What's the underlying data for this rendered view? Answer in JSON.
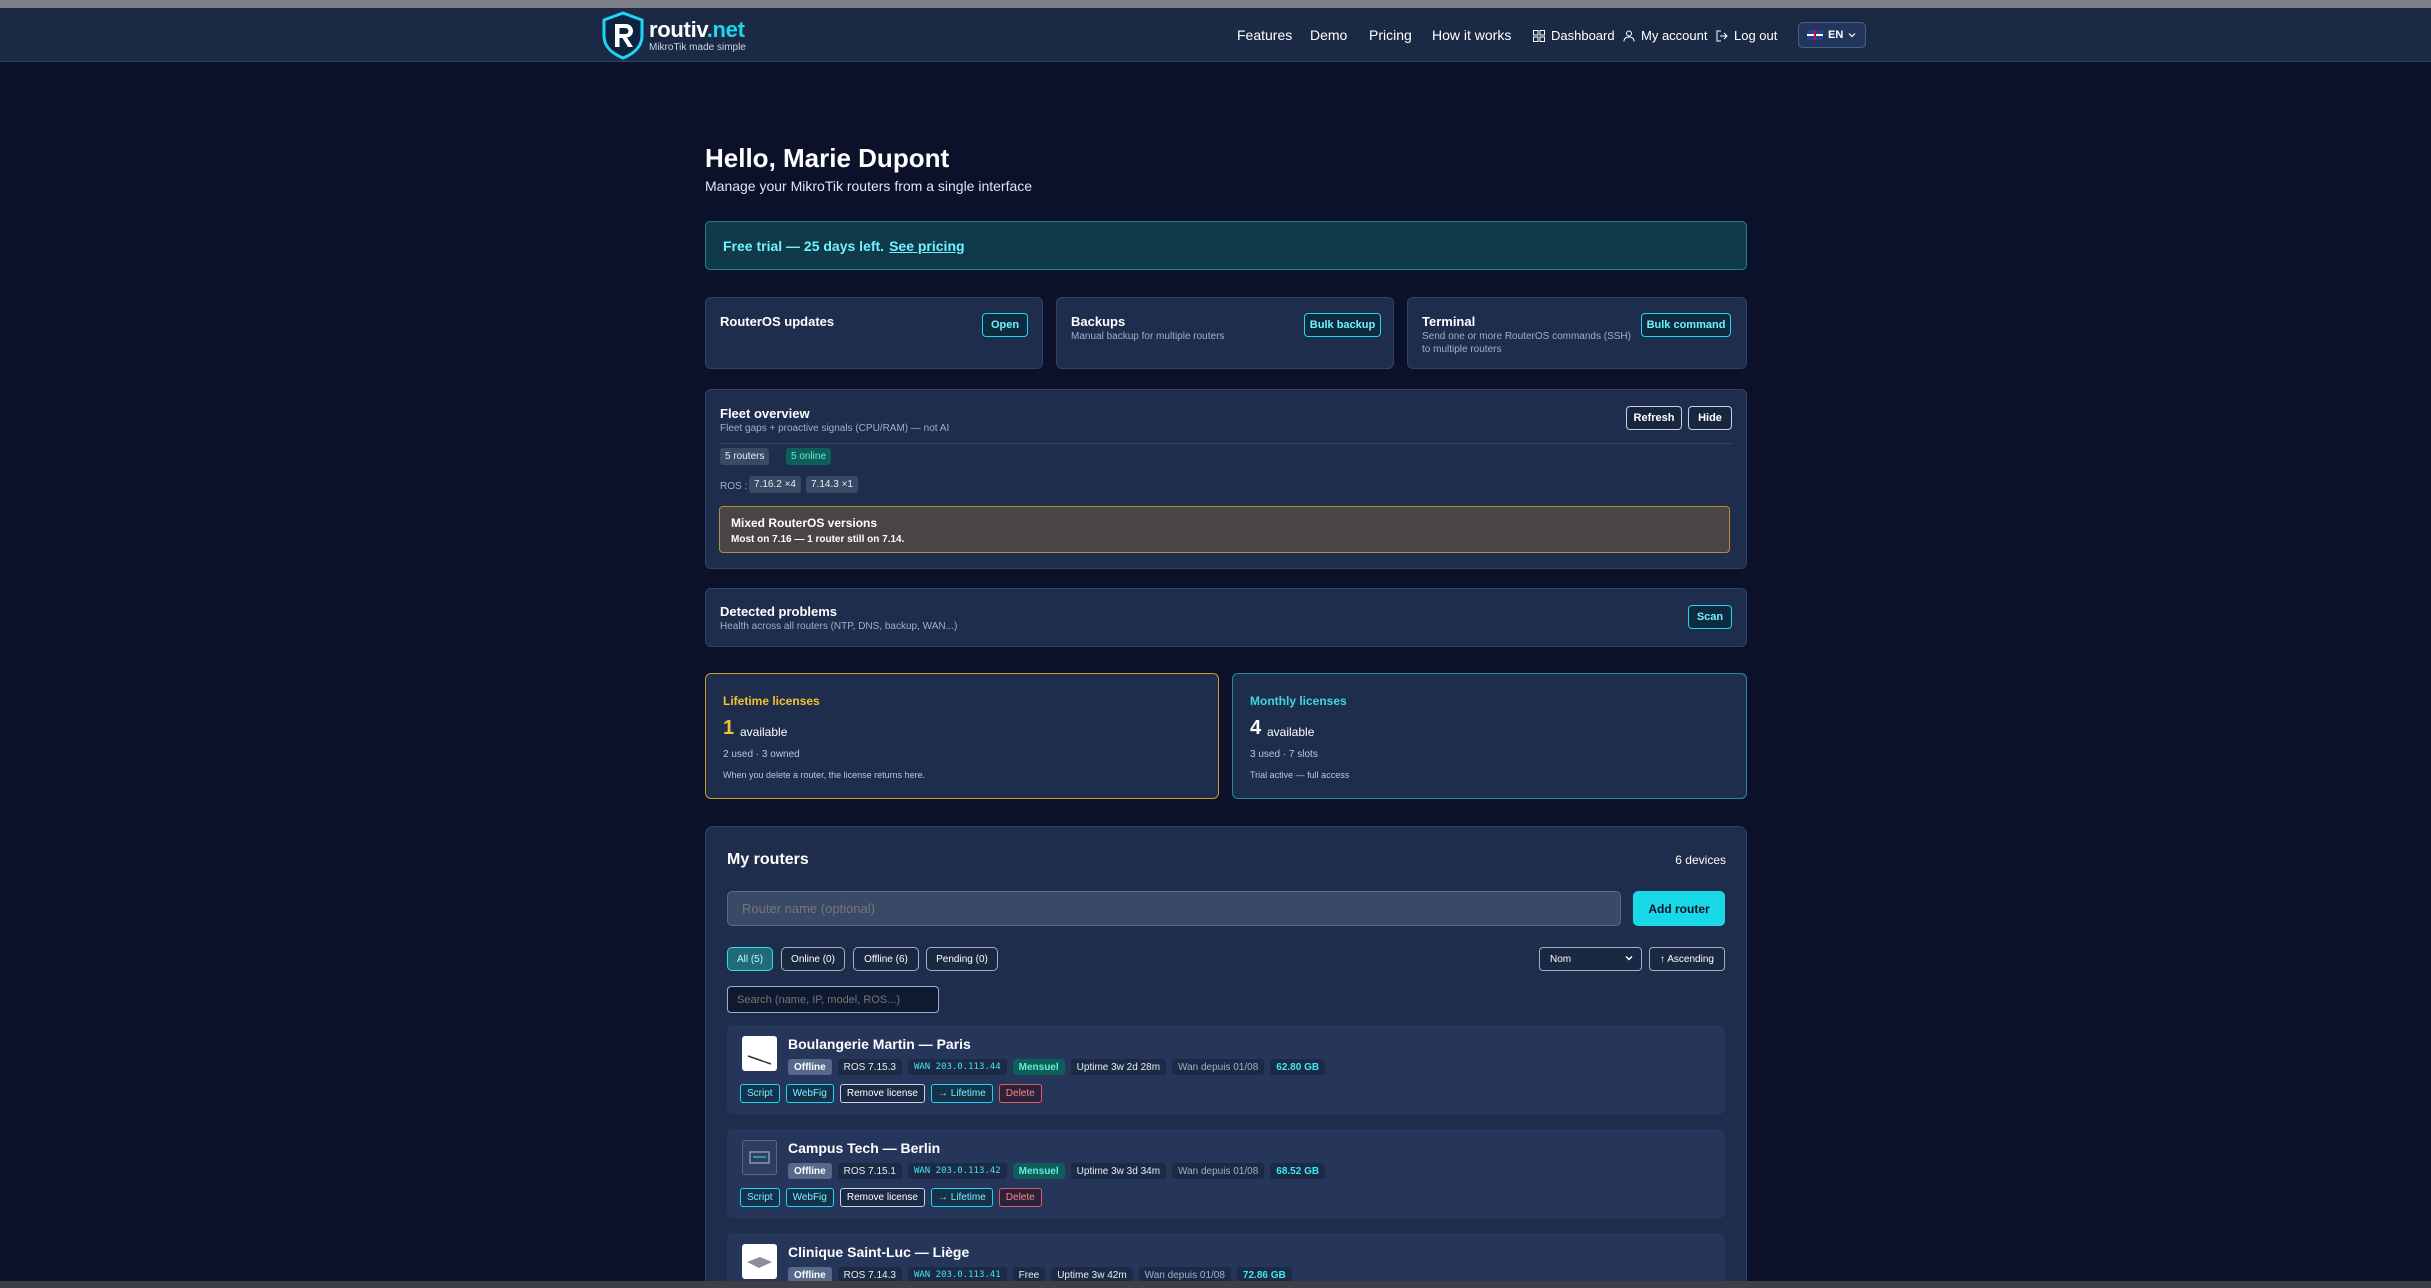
{
  "brand": {
    "name": "routiv",
    "tld": ".net",
    "tagline": "MikroTik made simple"
  },
  "nav": {
    "features": "Features",
    "demo": "Demo",
    "pricing": "Pricing",
    "how": "How it works",
    "dashboard": "Dashboard",
    "account": "My account",
    "logout": "Log out",
    "lang": "EN"
  },
  "header": {
    "greeting": "Hello, Marie Dupont",
    "subtitle": "Manage your MikroTik routers from a single interface"
  },
  "trial": {
    "text": "Free trial — 25 days left.",
    "link": "See pricing"
  },
  "tools": {
    "updates": {
      "title": "RouterOS updates",
      "button": "Open"
    },
    "backups": {
      "title": "Backups",
      "desc": "Manual backup for multiple routers",
      "button": "Bulk backup"
    },
    "terminal": {
      "title": "Terminal",
      "desc": "Send one or more RouterOS commands (SSH) to multiple routers",
      "button": "Bulk command"
    }
  },
  "fleet": {
    "title": "Fleet overview",
    "desc": "Fleet gaps + proactive signals (CPU/RAM) — not AI",
    "refresh": "Refresh",
    "hide": "Hide",
    "routers_pill": "5 routers",
    "online_pill": "5 online",
    "ros_label": "ROS :",
    "ros_a": "7.16.2 ×4",
    "ros_b": "7.14.3 ×1",
    "warn_title": "Mixed RouterOS versions",
    "warn_text": "Most on 7.16 — 1 router still on 7.14."
  },
  "problems": {
    "title": "Detected problems",
    "desc": "Health across all routers (NTP, DNS, backup, WAN...)",
    "button": "Scan"
  },
  "licenses": {
    "lifetime": {
      "title": "Lifetime licenses",
      "count": "1",
      "available": "available",
      "used": "2 used · 3 owned",
      "note": "When you delete a router, the license returns here.",
      "color": "#f2c230"
    },
    "monthly": {
      "title": "Monthly licenses",
      "count": "4",
      "available": "available",
      "used": "3 used · 7 slots",
      "note": "Trial active — full access",
      "color": "#3fd6e6"
    }
  },
  "routers": {
    "title": "My routers",
    "count": "6 devices",
    "name_placeholder": "Router name (optional)",
    "add": "Add router",
    "filters": {
      "all": "All (5)",
      "online": "Online (0)",
      "offline": "Offline (6)",
      "pending": "Pending (0)"
    },
    "sort": "Nom",
    "order": "↑ Ascending",
    "search_placeholder": "Search (name, IP, model, ROS...)",
    "items": [
      {
        "name": "Boulangerie Martin — Paris",
        "status": "Offline",
        "ros": "ROS 7.15.3",
        "wan": "WAN 203.0.113.44",
        "plan": "Mensuel",
        "uptime": "Uptime 3w 2d 28m",
        "since": "Wan depuis 01/08",
        "size": "62.80 GB",
        "actions": {
          "script": "Script",
          "webfig": "WebFig",
          "remove": "Remove license",
          "lifetime": "→ Lifetime",
          "delete": "Delete"
        }
      },
      {
        "name": "Campus Tech — Berlin",
        "status": "Offline",
        "ros": "ROS 7.15.1",
        "wan": "WAN 203.0.113.42",
        "plan": "Mensuel",
        "uptime": "Uptime 3w 3d 34m",
        "since": "Wan depuis 01/08",
        "size": "68.52 GB",
        "actions": {
          "script": "Script",
          "webfig": "WebFig",
          "remove": "Remove license",
          "lifetime": "→ Lifetime",
          "delete": "Delete"
        }
      },
      {
        "name": "Clinique Saint-Luc — Liège",
        "status": "Offline",
        "ros": "ROS 7.14.3",
        "wan": "WAN 203.0.113.41",
        "plan": "Free",
        "uptime": "Uptime 3w 42m",
        "since": "Wan depuis 01/08",
        "size": "72.86 GB"
      }
    ]
  }
}
